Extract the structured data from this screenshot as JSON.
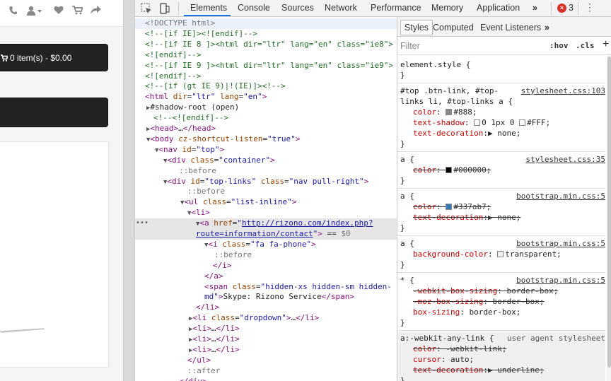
{
  "page": {
    "cart_label": "0 item(s) - $0.00"
  },
  "toolbar": {
    "tabs": [
      "Elements",
      "Console",
      "Sources",
      "Network",
      "Performance",
      "Memory",
      "Application"
    ],
    "more": "»",
    "error_count": "3",
    "menu": "⋮"
  },
  "dom_rows": [
    [
      "<span class='g'>&lt;!DOCTYPE html&gt;</span>"
    ],
    [
      "<span class='c'>&lt;!--[if IE]&gt;&lt;![endif]--&gt;</span>"
    ],
    [
      "<span class='c'>&lt;!--[if IE 8 ]&gt;&lt;html dir=\"ltr\" lang=\"en\" class=\"ie8\"&gt;</span>"
    ],
    [
      "<span class='c'>&lt;![endif]--&gt;</span>"
    ],
    [
      "<span class='c'>&lt;!--[if IE 9 ]&gt;&lt;html dir=\"ltr\" lang=\"en\" class=\"ie9\"&gt;</span>"
    ],
    [
      "<span class='c'>&lt;![endif]--&gt;</span>"
    ],
    [
      "<span class='c'>&lt;!--[if (gt IE 9)|!(IE)]&gt;&lt;!--&gt;</span>"
    ],
    [
      "<span class='t'>&lt;html</span> <span class='a'>dir</span>=<span class='v'>\"ltr\"</span> <span class='a'>lang</span>=<span class='v'>\"en\"</span><span class='t'>&gt;</span>"
    ],
    [
      "<span class='tri'>▶</span>#shadow-root (open)"
    ],
    [
      "<span class='c'>&lt;!--&lt;![endif]--&gt;</span>"
    ],
    [
      "<span class='tri'>▶</span><span class='t'>&lt;head&gt;</span>…<span class='t'>&lt;/head&gt;</span>"
    ],
    [
      "<span class='tri'>▼</span><span class='t'>&lt;body</span> <span class='a'>cz-shortcut-listen</span>=<span class='v'>\"true\"</span><span class='t'>&gt;</span>"
    ],
    [
      "<span class='tri'>▼</span><span class='t'>&lt;nav</span> <span class='a'>id</span>=<span class='v'>\"top\"</span><span class='t'>&gt;</span>"
    ],
    [
      "<span class='tri'>▼</span><span class='t'>&lt;div</span> <span class='a'>class</span>=<span class='v'>\"container\"</span><span class='t'>&gt;</span>"
    ],
    [
      "<span class='g'>::before</span>"
    ],
    [
      "<span class='tri'>▼</span><span class='t'>&lt;div</span> <span class='a'>id</span>=<span class='v'>\"top-links\"</span> <span class='a'>class</span>=<span class='v'>\"nav pull-right\"</span><span class='t'>&gt;</span>"
    ],
    [
      "<span class='g'>::before</span>"
    ],
    [
      "<span class='tri'>▼</span><span class='t'>&lt;ul</span> <span class='a'>class</span>=<span class='v'>\"list-inline\"</span><span class='t'>&gt;</span>"
    ],
    [
      "<span class='tri'>▼</span><span class='t'>&lt;li&gt;</span>"
    ],
    [
      "<span class='tri'>▼</span><span class='t'>&lt;a</span> <span class='a'>href</span>=<span class='v'>\"</span><span class='link'>http://rizono.com/index.php?</span>"
    ],
    [
      "<span class='link'>route=information/contact</span><span class='v'>\"</span><span class='t'>&gt;</span> == <span class='g'>$0</span>"
    ],
    [
      "<span class='tri'>▼</span><span class='t'>&lt;i</span> <span class='a'>class</span>=<span class='v'>\"fa fa-phone\"</span><span class='t'>&gt;</span>"
    ],
    [
      "<span class='g'>::before</span>"
    ],
    [
      "<span class='t'>&lt;/i&gt;</span>"
    ],
    [
      "<span class='t'>&lt;/a&gt;</span>"
    ],
    [
      "<span class='t'>&lt;span</span> <span class='a'>class</span>=<span class='v'>\"hidden-xs hidden-sm hidden-</span>"
    ],
    [
      "<span class='v'>md\"</span><span class='t'>&gt;</span>Skype: Rizono Service<span class='t'>&lt;/span&gt;</span>"
    ],
    [
      "<span class='t'>&lt;/li&gt;</span>"
    ],
    [
      "<span class='tri'>▶</span><span class='t'>&lt;li</span> <span class='a'>class</span>=<span class='v'>\"dropdown\"</span><span class='t'>&gt;</span>…<span class='t'>&lt;/li&gt;</span>"
    ],
    [
      "<span class='tri'>▶</span><span class='t'>&lt;li&gt;</span>…<span class='t'>&lt;/li&gt;</span>"
    ],
    [
      "<span class='tri'>▶</span><span class='t'>&lt;li&gt;</span>…<span class='t'>&lt;/li&gt;</span>"
    ],
    [
      "<span class='tri'>▶</span><span class='t'>&lt;li&gt;</span>…<span class='t'>&lt;/li&gt;</span>"
    ],
    [
      "<span class='t'>&lt;/ul&gt;</span>"
    ],
    [
      "<span class='g'>::after</span>"
    ],
    [
      "<span class='t'>&lt;/div&gt;</span>"
    ]
  ],
  "styles": {
    "tabs": [
      "Styles",
      "Computed",
      "Event Listeners"
    ],
    "more": "»",
    "filter_placeholder": "Filter",
    "hov": ":hov",
    "cls": ".cls",
    "plus": "+",
    "rules": [
      {
        "selector": "element.style {",
        "source": "",
        "lines": [
          "}"
        ]
      },
      {
        "selector": "#top .btn-link, #top-",
        "source": "stylesheet.css:103",
        "lines": [
          "links li, #top-links a {",
          "<span class='prop'>color</span>: <span class='sw' style='background:#888'></span>#888;",
          "<span class='prop'>text-shadow</span>: <span class='sw' style='background:#fff'></span>0 1px 0 <span class='sw' style='background:#fff'></span>#FFF;",
          "<span class='prop'>text-decoration</span>:▶ none;",
          "}"
        ]
      },
      {
        "selector": "a {",
        "source": "stylesheet.css:35",
        "lines": [
          "<span class='strike'><span class='prop'>color</span>: <span class='sw' style='background:#000'></span>#000000;</span>",
          "}"
        ]
      },
      {
        "selector": "a {",
        "source": "bootstrap.min.css:5",
        "lines": [
          "<span class='strike'><span class='prop'>color</span>: <span class='sw' style='background:#337ab7'></span>#337ab7;</span>",
          "<span class='strike'><span class='prop'>text-decoration</span>:▶ none;</span>",
          "}"
        ]
      },
      {
        "selector": "a {",
        "source": "bootstrap.min.css:5",
        "lines": [
          "<span class='prop'>background-color</span>: <span class='sw' style='background:#f0f0f0'></span>transparent;",
          "}"
        ]
      },
      {
        "selector": "* {",
        "source": "bootstrap.min.css:5",
        "lines": [
          "<span class='strike'><span class='prop'>-webkit-box-sizing</span>: border-box;</span>",
          "<span class='strike'><span class='prop'>-moz-box-sizing</span>: border-box;</span>",
          "<span class='prop'>box-sizing</span>: border-box;",
          "}"
        ]
      },
      {
        "selector": "a:-webkit-any-link {",
        "source": "user agent stylesheet",
        "lines": [
          "<span class='strike'><span class='prop'>color</span>: -webkit-link;</span>",
          "<span class='prop'>cursor</span>: auto;",
          "<span class='strike'><span class='prop'>text-decoration</span>:▶ underline;</span>",
          "}"
        ]
      }
    ]
  }
}
